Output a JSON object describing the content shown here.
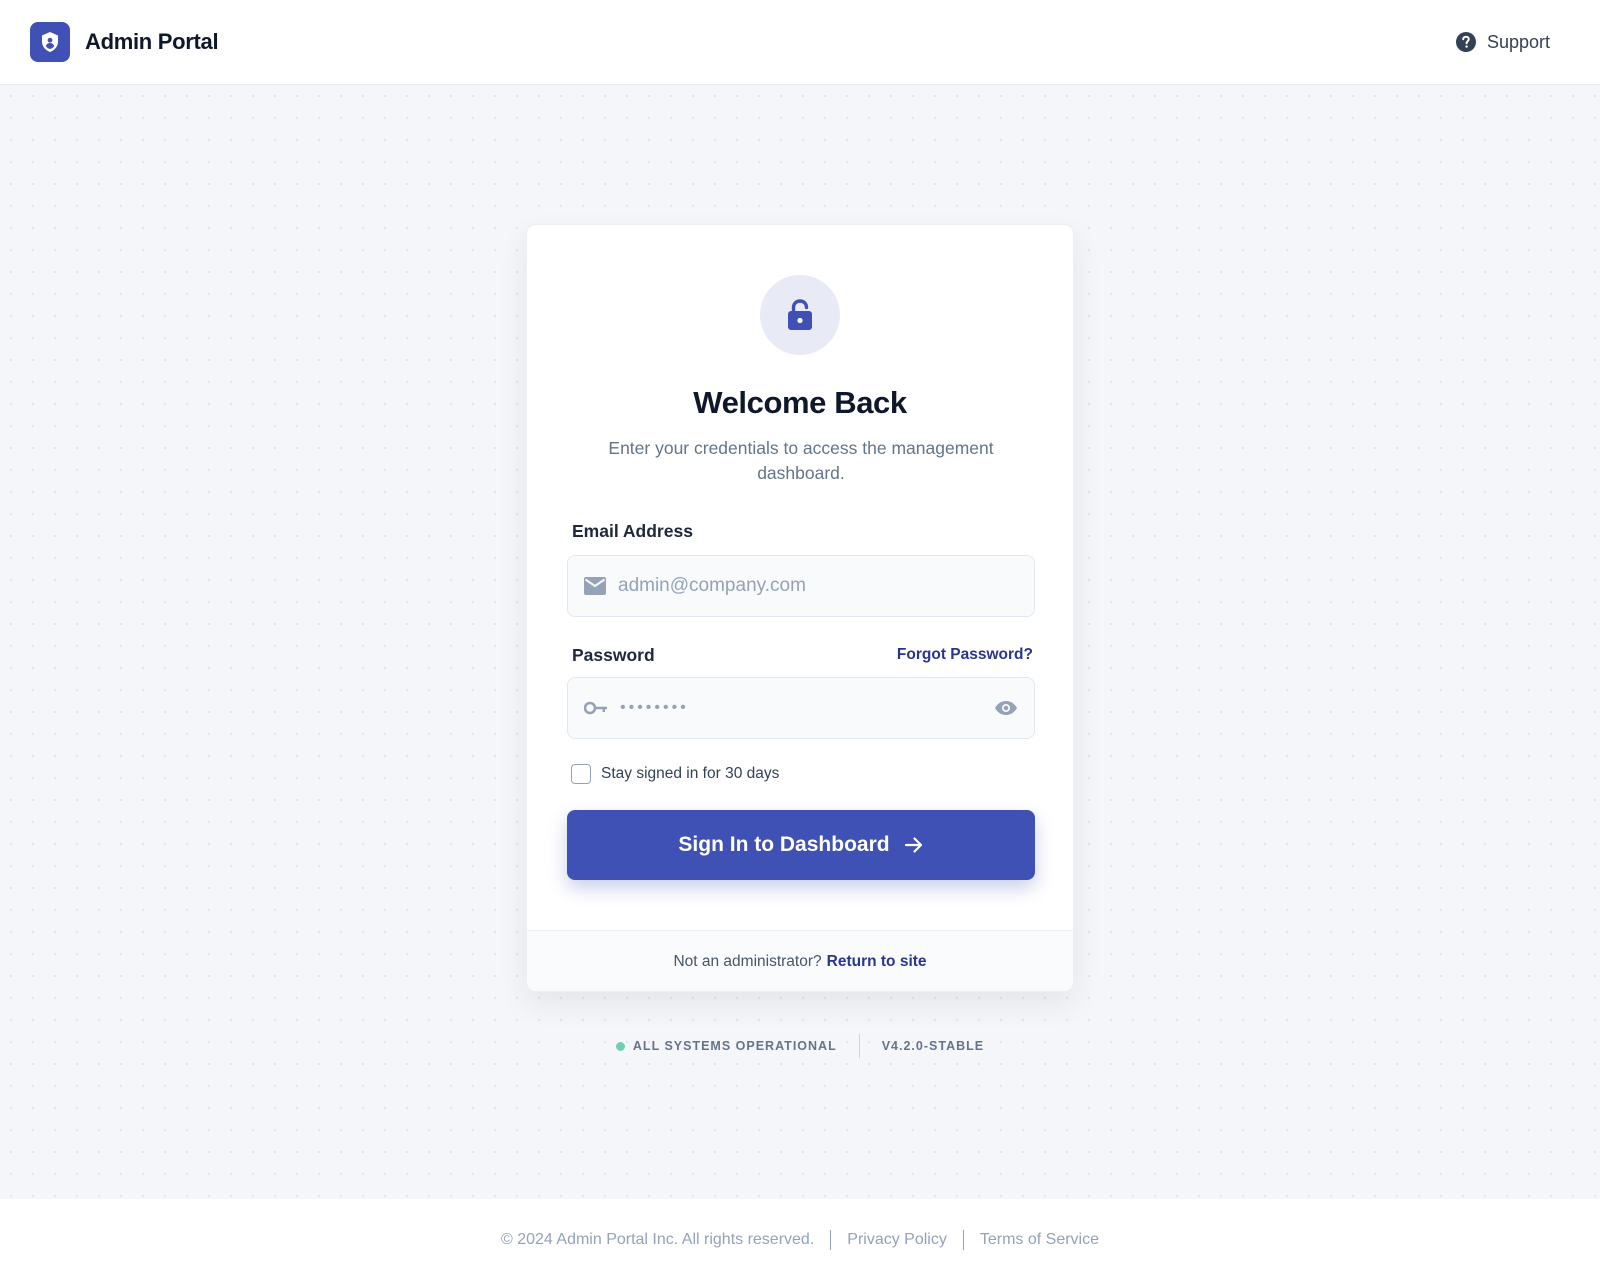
{
  "header": {
    "brand_title": "Admin Portal",
    "support_label": "Support"
  },
  "card": {
    "title": "Welcome Back",
    "subtitle": "Enter your credentials to access the management dashboard.",
    "email": {
      "label": "Email Address",
      "placeholder": "admin@company.com",
      "value": ""
    },
    "password": {
      "label": "Password",
      "masked_value": "••••••••",
      "forgot_label": "Forgot Password?"
    },
    "remember_label": "Stay signed in for 30 days",
    "remember_checked": false,
    "signin_label": "Sign In to Dashboard",
    "footer": {
      "prompt": "Not an administrator?",
      "link": "Return to site"
    }
  },
  "status": {
    "text": "ALL SYSTEMS OPERATIONAL",
    "version": "V4.2.0-STABLE",
    "color": "#6fcfae"
  },
  "footer": {
    "copyright": "© 2024 Admin Portal Inc. All rights reserved.",
    "privacy": "Privacy Policy",
    "terms": "Terms of Service"
  },
  "colors": {
    "accent": "#3f51b5",
    "link": "#283593",
    "lock_circle_bg": "#e8eaf6"
  },
  "icons": {
    "brand": "shield-user-icon",
    "support": "question-circle-icon",
    "lock": "unlock-icon",
    "email": "mail-icon",
    "password": "key-icon",
    "visibility": "eye-icon",
    "signin": "arrow-right-icon"
  }
}
